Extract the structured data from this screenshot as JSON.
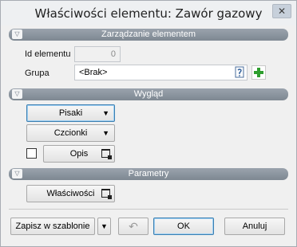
{
  "window": {
    "title": "Właściwości elementu: Zawór gazowy",
    "close_symbol": "✕"
  },
  "sections": {
    "management": {
      "title": "Zarządzanie elementem"
    },
    "appearance": {
      "title": "Wygląd"
    },
    "parameters": {
      "title": "Parametry"
    }
  },
  "fields": {
    "element_id": {
      "label": "Id elementu",
      "value": "0"
    },
    "group": {
      "label": "Grupa",
      "value": "<Brak>"
    }
  },
  "appearance": {
    "pens_label": "Pisaki",
    "fonts_label": "Czcionki",
    "description_label": "Opis"
  },
  "parameters": {
    "properties_label": "Właściwości"
  },
  "footer": {
    "save_template_label": "Zapisz w szablonie",
    "ok_label": "OK",
    "cancel_label": "Anuluj"
  },
  "icons": {
    "section_chevron": "▽",
    "dropdown": "▼",
    "undo": "↶",
    "add_color": "#2e9e2e"
  }
}
